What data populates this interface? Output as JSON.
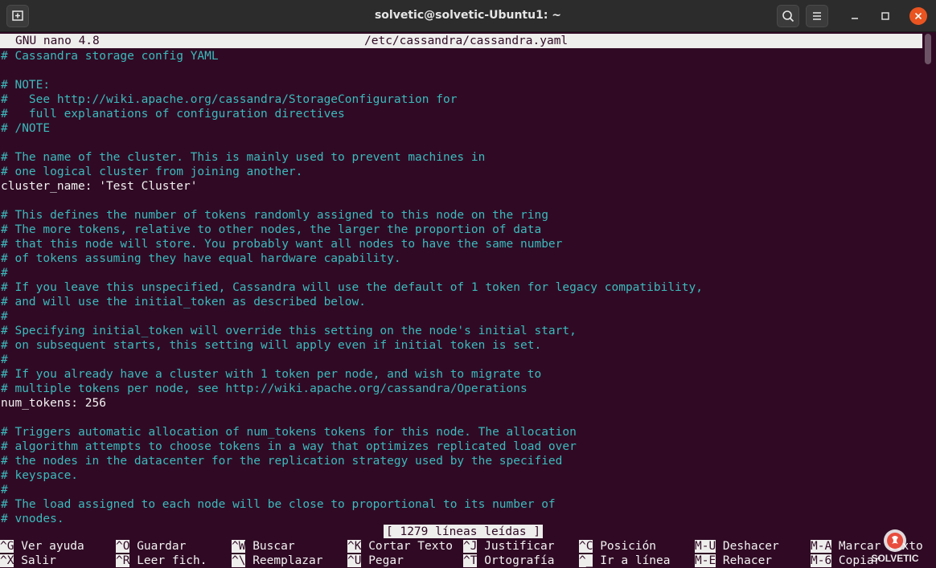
{
  "window": {
    "title": "solvetic@solvetic-Ubuntu1: ~"
  },
  "nano": {
    "version": "GNU nano 4.8",
    "filename": "/etc/cassandra/cassandra.yaml",
    "status_message": "[ 1279 líneas leídas ]"
  },
  "lines": [
    {
      "text": "# Cassandra storage config YAML",
      "type": "comment"
    },
    {
      "text": "",
      "type": "plain"
    },
    {
      "text": "# NOTE:",
      "type": "comment"
    },
    {
      "text": "#   See http://wiki.apache.org/cassandra/StorageConfiguration for",
      "type": "comment"
    },
    {
      "text": "#   full explanations of configuration directives",
      "type": "comment"
    },
    {
      "text": "# /NOTE",
      "type": "comment"
    },
    {
      "text": "",
      "type": "plain"
    },
    {
      "text": "# The name of the cluster. This is mainly used to prevent machines in",
      "type": "comment"
    },
    {
      "text": "# one logical cluster from joining another.",
      "type": "comment"
    },
    {
      "text": "cluster_name: 'Test Cluster'",
      "type": "plain"
    },
    {
      "text": "",
      "type": "plain"
    },
    {
      "text": "# This defines the number of tokens randomly assigned to this node on the ring",
      "type": "comment"
    },
    {
      "text": "# The more tokens, relative to other nodes, the larger the proportion of data",
      "type": "comment"
    },
    {
      "text": "# that this node will store. You probably want all nodes to have the same number",
      "type": "comment"
    },
    {
      "text": "# of tokens assuming they have equal hardware capability.",
      "type": "comment"
    },
    {
      "text": "#",
      "type": "comment"
    },
    {
      "text": "# If you leave this unspecified, Cassandra will use the default of 1 token for legacy compatibility,",
      "type": "comment"
    },
    {
      "text": "# and will use the initial_token as described below.",
      "type": "comment"
    },
    {
      "text": "#",
      "type": "comment"
    },
    {
      "text": "# Specifying initial_token will override this setting on the node's initial start,",
      "type": "comment"
    },
    {
      "text": "# on subsequent starts, this setting will apply even if initial token is set.",
      "type": "comment"
    },
    {
      "text": "#",
      "type": "comment"
    },
    {
      "text": "# If you already have a cluster with 1 token per node, and wish to migrate to",
      "type": "comment"
    },
    {
      "text": "# multiple tokens per node, see http://wiki.apache.org/cassandra/Operations",
      "type": "comment"
    },
    {
      "text": "num_tokens: 256",
      "type": "plain"
    },
    {
      "text": "",
      "type": "plain"
    },
    {
      "text": "# Triggers automatic allocation of num_tokens tokens for this node. The allocation",
      "type": "comment"
    },
    {
      "text": "# algorithm attempts to choose tokens in a way that optimizes replicated load over",
      "type": "comment"
    },
    {
      "text": "# the nodes in the datacenter for the replication strategy used by the specified",
      "type": "comment"
    },
    {
      "text": "# keyspace.",
      "type": "comment"
    },
    {
      "text": "#",
      "type": "comment"
    },
    {
      "text": "# The load assigned to each node will be close to proportional to its number of",
      "type": "comment"
    },
    {
      "text": "# vnodes.",
      "type": "comment"
    }
  ],
  "shortcuts": {
    "row1": [
      {
        "key": "^G",
        "label": " Ver ayuda"
      },
      {
        "key": "^O",
        "label": " Guardar"
      },
      {
        "key": "^W",
        "label": " Buscar"
      },
      {
        "key": "^K",
        "label": " Cortar Texto"
      },
      {
        "key": "^J",
        "label": " Justificar"
      },
      {
        "key": "^C",
        "label": " Posición"
      },
      {
        "key": "M-U",
        "label": " Deshacer"
      },
      {
        "key": "M-A",
        "label": " Marcar texto"
      }
    ],
    "row2": [
      {
        "key": "^X",
        "label": " Salir"
      },
      {
        "key": "^R",
        "label": " Leer fich."
      },
      {
        "key": "^\\",
        "label": " Reemplazar"
      },
      {
        "key": "^U",
        "label": " Pegar"
      },
      {
        "key": "^T",
        "label": " Ortografía"
      },
      {
        "key": "^_",
        "label": " Ir a línea"
      },
      {
        "key": "M-E",
        "label": " Rehacer"
      },
      {
        "key": "M-6",
        "label": " Copiar"
      }
    ]
  },
  "colors": {
    "terminal_bg": "#300a24",
    "comment_text": "#3bbbbd",
    "plain_text": "#f2f2f2",
    "inverse_bg": "#eeeeec",
    "close_button": "#e95420"
  },
  "icons": {
    "new_tab": "new-tab-icon",
    "search": "search-icon",
    "menu": "hamburger-menu-icon",
    "minimize": "minimize-icon",
    "maximize": "maximize-icon",
    "close": "close-icon",
    "logo": "solvetic-logo"
  }
}
